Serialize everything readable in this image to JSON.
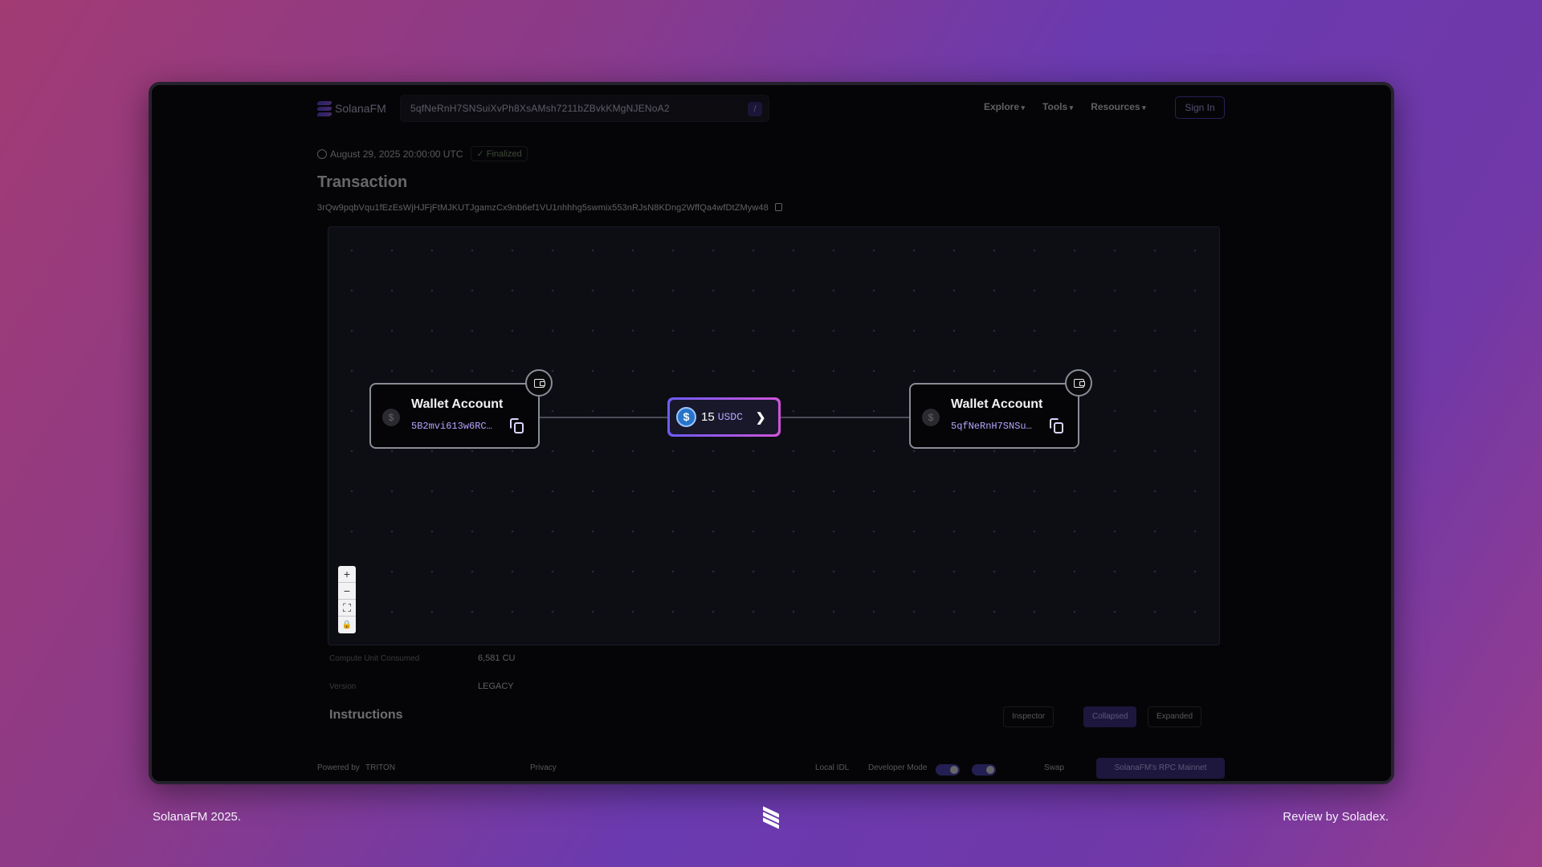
{
  "header": {
    "brand": "SolanaFM",
    "search_value": "5qfNeRnH7SNSuiXvPh8XsAMsh7211bZBvkKMgNJENoA2",
    "search_shortcut": "/",
    "nav": [
      "Explore",
      "Tools",
      "Resources"
    ],
    "signin": "Sign In"
  },
  "tx": {
    "date": "August 29, 2025 20:00:00 UTC",
    "status": "✓ Finalized",
    "title": "Transaction",
    "signature": "3rQw9pqbVqu1fEzEsWjHJFjFtMJKUTJgamzCx9nb6ef1VU1nhhhg5swmix553nRJsN8KDng2WffQa4wfDtZMyw48"
  },
  "graph": {
    "source": {
      "label": "Wallet Account",
      "address": "5B2mvi613w6RC…"
    },
    "dest": {
      "label": "Wallet Account",
      "address": "5qfNeRnH7SNSu…"
    },
    "transfer": {
      "amount": "15",
      "token": "USDC"
    },
    "zoom_controls": [
      "+",
      "−",
      "⛶",
      "🔒"
    ]
  },
  "details": {
    "rows": [
      {
        "label": "Compute Unit Consumed",
        "value": "6,581 CU"
      },
      {
        "label": "Version",
        "value": "LEGACY"
      }
    ],
    "instructions_title": "Instructions",
    "buttons": {
      "inspector": "Inspector",
      "collapsed": "Collapsed",
      "expanded": "Expanded"
    }
  },
  "footer": {
    "powered": "Powered by",
    "partner": "TRITON",
    "privacy": "Privacy",
    "local_idl": "Local IDL",
    "dev_mode": "Developer Mode",
    "swap": "Swap",
    "rpc": "SolanaFM's RPC Mainnet"
  },
  "captions": {
    "left": "SolanaFM 2025.",
    "right": "Review by Soladex."
  },
  "colors": {
    "accent": "#6d5cf5",
    "accent_pink": "#d154d8",
    "usdc": "#2775ca"
  }
}
